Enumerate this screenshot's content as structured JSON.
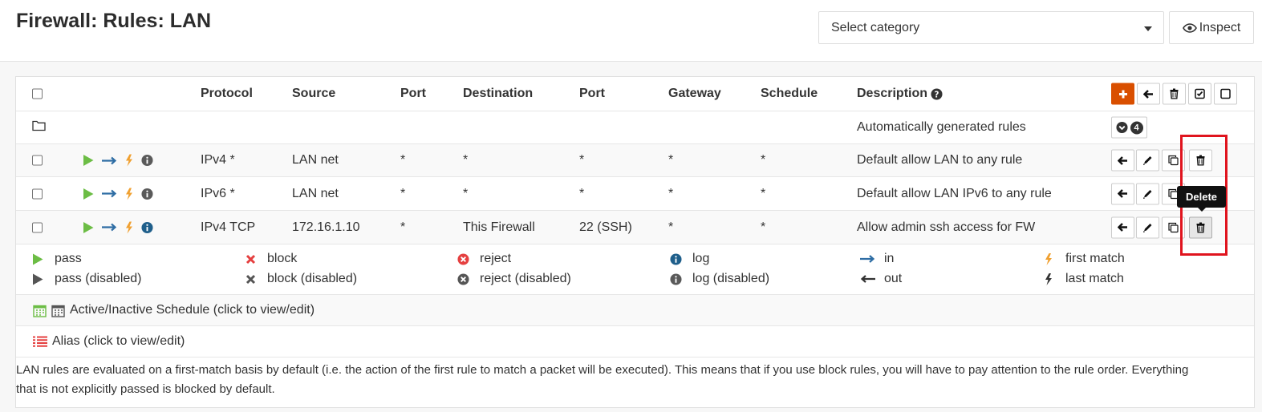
{
  "header": {
    "title": "Firewall: Rules: LAN",
    "category_select": {
      "selected": "Select category"
    },
    "inspect_label": "Inspect"
  },
  "table": {
    "columns": {
      "protocol": "Protocol",
      "source": "Source",
      "port": "Port",
      "destination": "Destination",
      "dest_port": "Port",
      "gateway": "Gateway",
      "schedule": "Schedule",
      "description": "Description"
    },
    "auto_group": {
      "description": "Automatically generated rules",
      "count": "4"
    },
    "rules": [
      {
        "protocol": "IPv4 *",
        "source": "LAN net",
        "port": "*",
        "destination": "*",
        "dest_port": "*",
        "gateway": "*",
        "schedule": "*",
        "description": "Default allow LAN to any rule"
      },
      {
        "protocol": "IPv6 *",
        "source": "LAN net",
        "port": "*",
        "destination": "*",
        "dest_port": "*",
        "gateway": "*",
        "schedule": "*",
        "description": "Default allow LAN IPv6 to any rule"
      },
      {
        "protocol": "IPv4 TCP",
        "source": "172.16.1.10",
        "port": "*",
        "destination": "This Firewall",
        "dest_port": "22 (SSH)",
        "gateway": "*",
        "schedule": "*",
        "description": "Allow admin ssh access for FW"
      }
    ]
  },
  "tooltip": "Delete",
  "legend": {
    "pass": "pass",
    "pass_disabled": "pass (disabled)",
    "block": "block",
    "block_disabled": "block (disabled)",
    "reject": "reject",
    "reject_disabled": "reject (disabled)",
    "log": "log",
    "log_disabled": "log (disabled)",
    "in": "in",
    "out": "out",
    "first_match": "first match",
    "last_match": "last match"
  },
  "schedule_legend": "Active/Inactive Schedule (click to view/edit)",
  "alias_legend": "Alias (click to view/edit)",
  "note": "LAN rules are evaluated on a first-match basis by default (i.e. the action of the first rule to match a packet will be executed). This means that if you use block rules, you will have to pay attention to the rule order. Everything that is not explicitly passed is blocked by default.",
  "colors": {
    "pass": "#6cbd45",
    "block": "#e54040",
    "accent": "#d94f00",
    "in_arrow": "#2e6da4",
    "first_match": "#f0a030",
    "highlight": "#e0141e"
  },
  "icons": [
    "eye-icon",
    "plus-icon",
    "arrow-left-icon",
    "trash-icon",
    "check-square-icon",
    "square-icon",
    "folder-icon",
    "chevron-down-icon",
    "play-icon",
    "arrow-right-icon",
    "bolt-icon",
    "info-icon",
    "pencil-icon",
    "copy-icon",
    "times-icon",
    "times-circle-icon",
    "arrow-left-long-icon",
    "calendar-icon",
    "list-icon",
    "question-circle-icon"
  ]
}
